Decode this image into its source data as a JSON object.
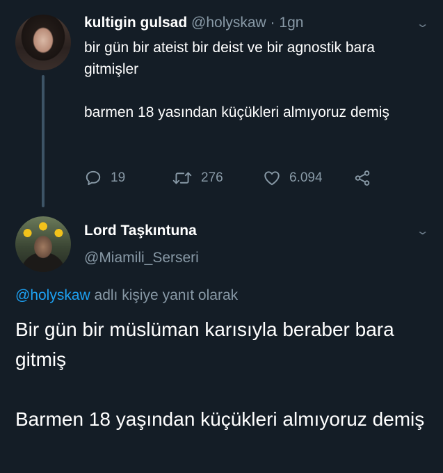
{
  "tweet1": {
    "author_name": "kultigin gulsad",
    "author_handle": "@holyskaw",
    "separator": "·",
    "time": "1gn",
    "text_para1": "bir gün bir ateist bir deist ve bir agnostik bara gitmişler",
    "text_para2": "barmen 18 yasından küçükleri almıyoruz demiş",
    "actions": {
      "replies": "19",
      "retweets": "276",
      "likes": "6.094"
    }
  },
  "tweet2": {
    "author_name": "Lord Taşkıntuna",
    "author_handle": "@Miamili_Serseri",
    "reply_mention": "@holyskaw",
    "reply_suffix": "adlı kişiye yanıt olarak",
    "text_para1": "Bir gün bir müslüman karısıyla beraber bara gitmiş",
    "text_para2": "Barmen 18 yaşından küçükleri almıyoruz demiş"
  },
  "colors": {
    "background": "#141d26",
    "primary_text": "#ffffff",
    "secondary_text": "#8899a6",
    "link": "#1da1f2",
    "thread_line": "#3d5466"
  },
  "icons": [
    "reply-icon",
    "retweet-icon",
    "like-icon",
    "share-icon",
    "chevron-down-icon"
  ]
}
